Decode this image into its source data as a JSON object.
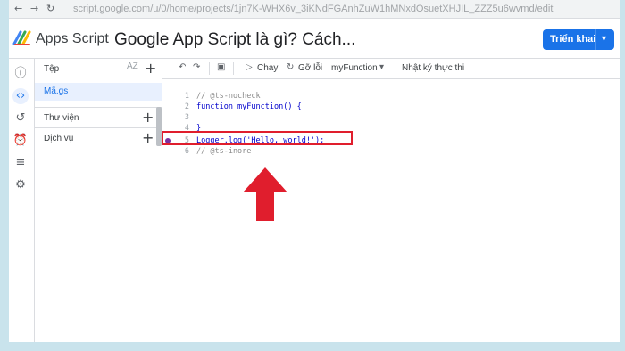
{
  "browser": {
    "url": "script.google.com/u/0/home/projects/1jn7K-WHX6v_3iKNdFGAnhZuW1hMNxdOsuetXHJIL_ZZZ5u6wvmd/edit"
  },
  "header": {
    "app_name": "Apps Script",
    "project_title": "Google App Script là gì? Cách...",
    "deploy_label": "Triển khai"
  },
  "files": {
    "title": "Tệp",
    "sort_label": "AZ",
    "items": [
      {
        "name": "Mã.gs"
      }
    ],
    "sections": [
      {
        "label": "Thư viện"
      },
      {
        "label": "Dịch vụ"
      }
    ]
  },
  "toolbar": {
    "run_label": "Chạy",
    "debug_label": "Gỡ lỗi",
    "function_select": "myFunction",
    "exec_log_label": "Nhật ký thực thi"
  },
  "code": {
    "lines": [
      {
        "n": "1",
        "text": "// @ts-nocheck"
      },
      {
        "n": "2",
        "text": "function myFunction() {"
      },
      {
        "n": "3",
        "text": ""
      },
      {
        "n": "4",
        "text": "}"
      },
      {
        "n": "5",
        "text": "Logger.log('Hello, world!');"
      },
      {
        "n": "6",
        "text": "// @ts-inore"
      }
    ]
  },
  "colors": {
    "accent": "#1a73e8",
    "highlight": "#e01e2d",
    "background": "#c9e3ec"
  },
  "icons": [
    "info-icon",
    "code-icon",
    "history-icon",
    "alarm-icon",
    "executions-icon",
    "settings-icon",
    "undo-icon",
    "redo-icon",
    "save-icon",
    "play-icon",
    "debug-icon"
  ]
}
